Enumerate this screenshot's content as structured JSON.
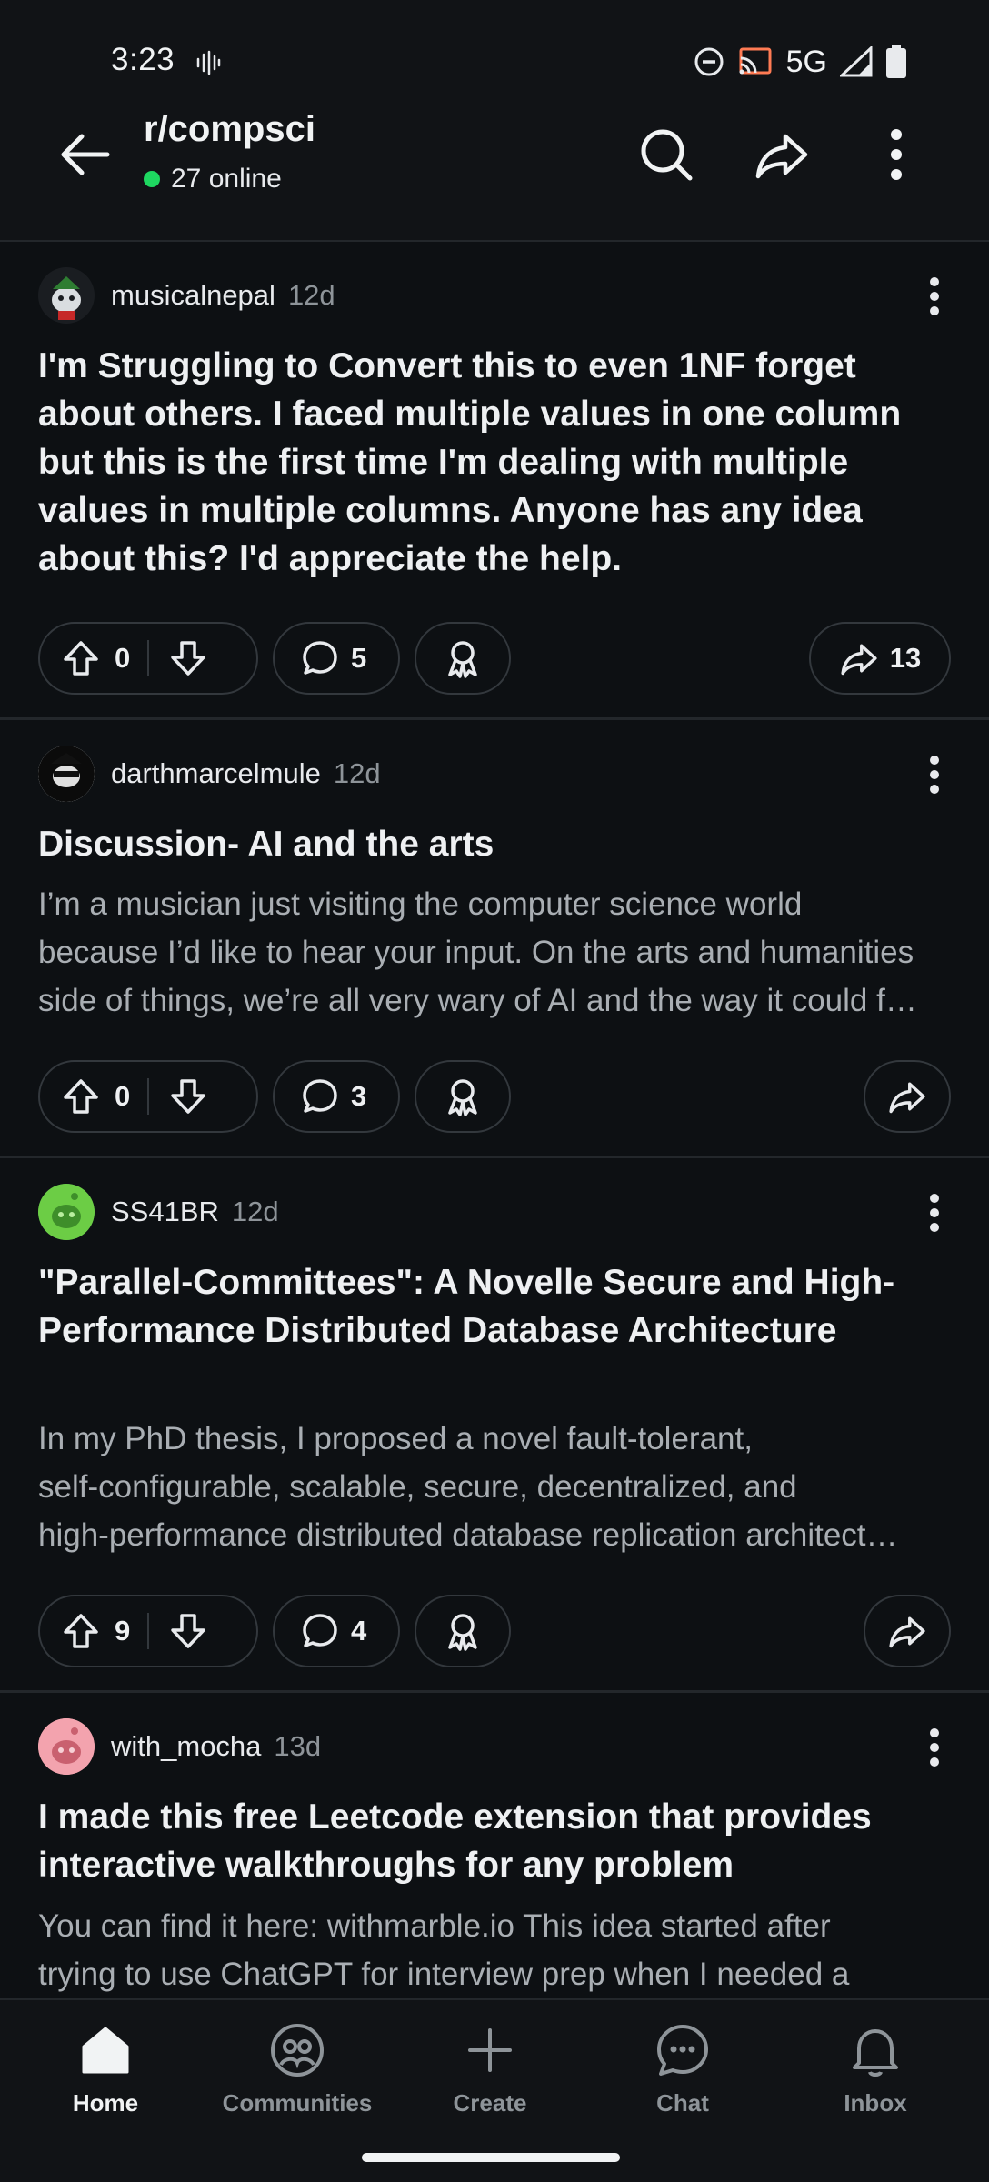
{
  "status_bar": {
    "time": "3:23",
    "network": "5G"
  },
  "header": {
    "subreddit": "r/compsci",
    "online_text": "27 online"
  },
  "posts": [
    {
      "author": "musicalnepal",
      "age": "12d",
      "title": "I'm Struggling to Convert this to even 1NF forget about others. I faced multiple values in one column but this is the first time I'm dealing with multiple values in multiple columns. Anyone has any idea about this? I'd appreciate the help.",
      "body": "",
      "upvotes": "0",
      "comments": "5",
      "shares": "13"
    },
    {
      "author": "darthmarcelmule",
      "age": "12d",
      "title": "Discussion- AI and the arts",
      "body_lines": [
        "I’m a musician just visiting the computer science world",
        "because I’d like to hear your input. On the arts and humanities",
        "side of things, we’re all very wary of AI and the way it could f…"
      ],
      "upvotes": "0",
      "comments": "3"
    },
    {
      "author": "SS41BR",
      "age": "12d",
      "title": "\"Parallel-Committees\": A Novelle Secure and High-Performance Distributed Database Architecture",
      "body_lines": [
        "In my PhD thesis, I proposed a novel fault-tolerant,",
        "self-configurable, scalable, secure, decentralized, and",
        "high-performance distributed database replication architect…"
      ],
      "upvotes": "9",
      "comments": "4"
    },
    {
      "author": "with_mocha",
      "age": "13d",
      "title": "I made this free Leetcode extension that provides interactive walkthroughs for any problem",
      "body_lines": [
        "You can find it here: withmarble.io This idea started after",
        "trying to use ChatGPT for interview prep when I needed a"
      ]
    }
  ],
  "bottom_nav": [
    {
      "label": "Home",
      "icon": "home-icon",
      "active": true
    },
    {
      "label": "Communities",
      "icon": "communities-icon"
    },
    {
      "label": "Create",
      "icon": "plus-icon"
    },
    {
      "label": "Chat",
      "icon": "chat-icon"
    },
    {
      "label": "Inbox",
      "icon": "bell-icon"
    }
  ],
  "colors": {
    "background": "#0d1013",
    "online_dot": "#1ed760",
    "pill_border": "#33383d"
  }
}
